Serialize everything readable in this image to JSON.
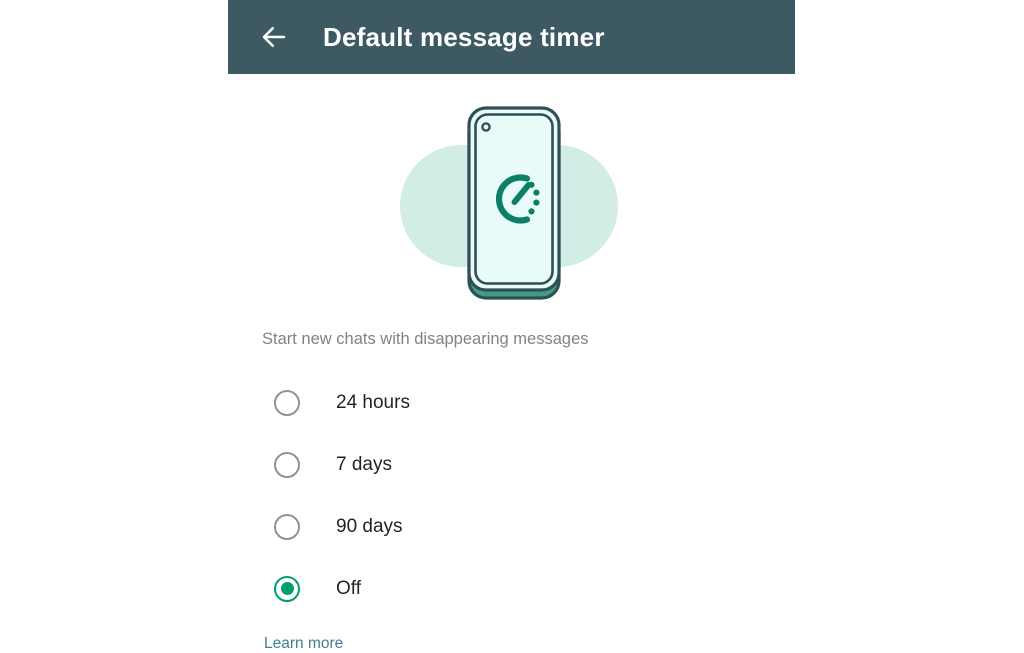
{
  "window": {
    "background_color": "#ffffff"
  },
  "appbar": {
    "title": "Default message timer",
    "back_icon": "arrow-left-icon",
    "background_color": "#3d5a63",
    "title_color": "#ffffff"
  },
  "illustration": {
    "name": "disappearing-messages-phone-timer-illustration",
    "blob_color": "#d2ede5",
    "phone_outline_color": "#2e5055",
    "phone_screen_color": "#e9fbf8",
    "phone_base_color": "#3f9b86",
    "timer_color": "#0e7f67",
    "camera_dot": "camera-dot-icon"
  },
  "content": {
    "subtitle": "Start new chats with disappearing messages",
    "subtitle_color": "#7d8488",
    "options": [
      {
        "label": "24 hours",
        "selected": false
      },
      {
        "label": "7 days",
        "selected": false
      },
      {
        "label": "90 days",
        "selected": false
      },
      {
        "label": "Off",
        "selected": true
      }
    ],
    "selected_value": "Off",
    "learn_more_label": "Learn more",
    "link_color": "#417f90",
    "radio_selected_color": "#039e70",
    "radio_unselected_color": "#8d9499"
  }
}
